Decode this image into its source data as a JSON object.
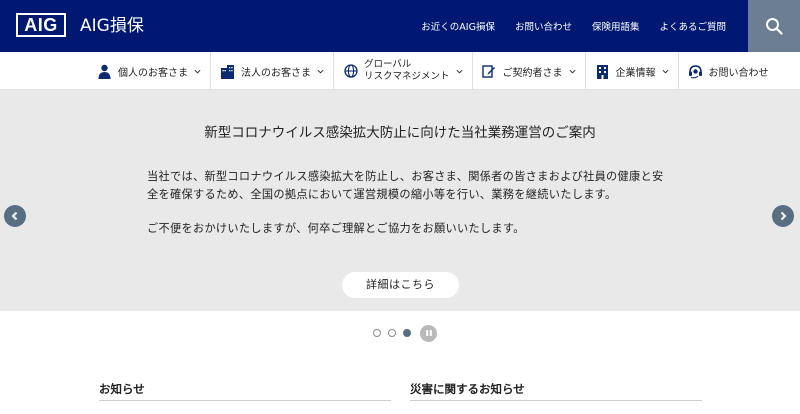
{
  "header": {
    "logo_text": "AIG",
    "brand_name": "AIG損保",
    "links": [
      "お近くのAIG損保",
      "お問い合わせ",
      "保険用語集",
      "よくあるご質問"
    ]
  },
  "nav": {
    "items": [
      {
        "label": "個人のお客さま",
        "icon": "person-icon"
      },
      {
        "label": "法人のお客さま",
        "icon": "building-icon"
      },
      {
        "label_line1": "グローバル",
        "label_line2": "リスクマネジメント",
        "icon": "globe-icon"
      },
      {
        "label": "ご契約者さま",
        "icon": "edit-doc-icon"
      },
      {
        "label": "企業情報",
        "icon": "office-icon"
      },
      {
        "label": "お問い合わせ",
        "icon": "headset-icon"
      }
    ]
  },
  "hero": {
    "title": "新型コロナウイルス感染拡大防止に向けた当社業務運営のご案内",
    "paragraph1": "当社では、新型コロナウイルス感染拡大を防止し、お客さま、関係者の皆さまおよび社員の健康と安全を確保するため、全国の拠点において運営規模の縮小等を行い、業務を継続いたします。",
    "paragraph2": "ご不便をおかけいたしますが、何卒ご理解とご協力をお願いいたします。",
    "button_label": "詳細はこちら"
  },
  "carousel": {
    "slide_count": 3,
    "active_index": 3
  },
  "sections": {
    "news_title": "お知らせ",
    "disaster_title": "災害に関するお知らせ"
  },
  "colors": {
    "header_bg": "#001871",
    "search_bg": "#6c7f92",
    "hero_bg": "#e9e9e9",
    "arrow_bg": "#5a6e82"
  }
}
